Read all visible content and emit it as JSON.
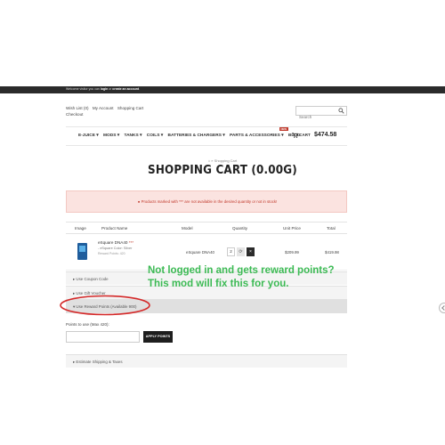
{
  "topbar": {
    "message_pre": "Welcome visitor you can ",
    "login": "login",
    "message_mid": " or ",
    "create": "create an account",
    "message_end": "."
  },
  "header": {
    "wishlist": "Wish List (0)",
    "account": "My Account",
    "cart": "Shopping Cart",
    "checkout": "Checkout"
  },
  "search": {
    "placeholder": "Search"
  },
  "nav": {
    "items": [
      "E-JUICE ▾",
      "MODS ▾",
      "TANKS ▾",
      "COILS ▾",
      "BATTERIES & CHARGERS ▾",
      "PARTS & ACCESSORIES ▾",
      "BLOG"
    ],
    "new_badge": "NEW",
    "cart_label": "CART",
    "cart_total": "$474.58"
  },
  "breadcrumb": {
    "home_icon": "home-icon",
    "sep": "»",
    "current": "Shopping Cart"
  },
  "page_title": "SHOPPING CART (0.00G)",
  "alert": {
    "text": "Products marked with *** are not available in the desired quantity or not in stock!"
  },
  "table": {
    "headers": [
      "Image",
      "Product Name",
      "Model",
      "Quantity",
      "Unit Price",
      "Total"
    ],
    "row": {
      "name": "eSquare DNA40",
      "stars": "***",
      "option": "- eSquare Color: Silver",
      "points": "Reward Points: 420",
      "model": "eSquare DNA40",
      "qty": "2",
      "unit_price": "$209.99",
      "total": "$419.98"
    }
  },
  "accordion": {
    "coupon": "▸ Use Coupon Code",
    "voucher": "▸ Use Gift Voucher",
    "reward": "▾ Use Reward Points (Available 900)",
    "shipping": "▸ Estimate Shipping & Taxes"
  },
  "callout": {
    "line1": "Not logged in and gets reward points?",
    "line2": "This mod will fix this for you."
  },
  "reward_form": {
    "label": "Points to use (Max 420):",
    "value": "",
    "apply": "APPLY POINTS"
  },
  "colors": {
    "callout": "#3cba54",
    "annotation_oval": "#d42a2a",
    "alert_bg": "#fbe3e0",
    "alert_text": "#c0392b",
    "dark": "#2b2b2b"
  }
}
